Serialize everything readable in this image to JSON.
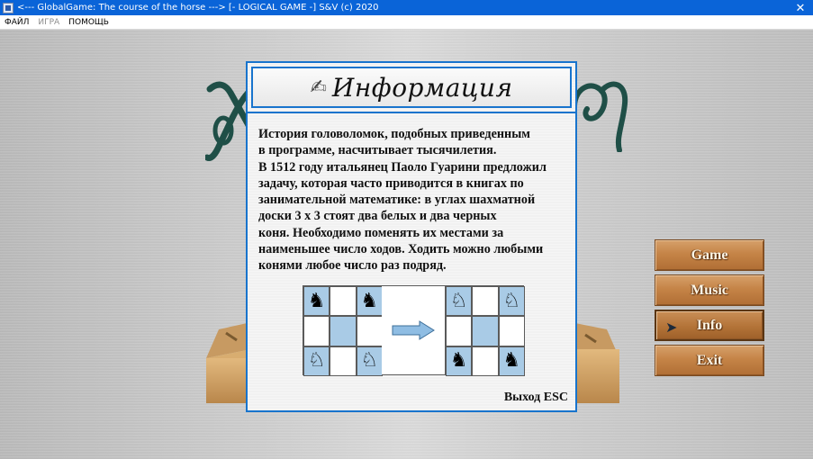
{
  "window": {
    "title": "<--- GlobalGame:  The course of the horse ---> [- LOGICAL GAME -]  S&V (c) 2020",
    "close_glyph": "✕"
  },
  "menu": {
    "items": [
      {
        "label": "ФАЙЛ",
        "enabled": true
      },
      {
        "label": "ИГРА",
        "enabled": false
      },
      {
        "label": "ПОМОЩЬ",
        "enabled": true
      }
    ]
  },
  "dialog": {
    "title": "Информация",
    "title_icon": "pen-writing-icon",
    "lines": [
      "История головоломок, подобных приведенным",
      "в программе, насчитывает тысячилетия.",
      "В 1512 году итальянец Паоло Гуарини предложил",
      "задачу, которая часто приводится в книгах по",
      "занимательной математике: в углах шахматной",
      "доски  3 x 3  стоят два белых и два черных",
      "коня. Необходимо поменять их местами за",
      "наименьшее число ходов. Ходить можно любыми",
      "конями любое число раз подряд."
    ],
    "exit_label": "Выход ESC",
    "puzzle": {
      "before": [
        [
          "black",
          "",
          "black"
        ],
        [
          "",
          "",
          ""
        ],
        [
          "white",
          "",
          "white"
        ]
      ],
      "after": [
        [
          "white",
          "",
          "white"
        ],
        [
          "",
          "",
          ""
        ],
        [
          "black",
          "",
          "black"
        ]
      ],
      "arrow_color": "#8fbde3"
    }
  },
  "side_menu": {
    "buttons": [
      {
        "label": "Game",
        "active": false
      },
      {
        "label": "Music",
        "active": false
      },
      {
        "label": "Info",
        "active": true
      },
      {
        "label": "Exit",
        "active": false
      }
    ]
  },
  "colors": {
    "titlebar": "#0a64d8",
    "dialog_border": "#1874cd",
    "button_wood": "#c58447",
    "deco_green": "#1f4f47",
    "board_dark": "#a9cbe6"
  }
}
